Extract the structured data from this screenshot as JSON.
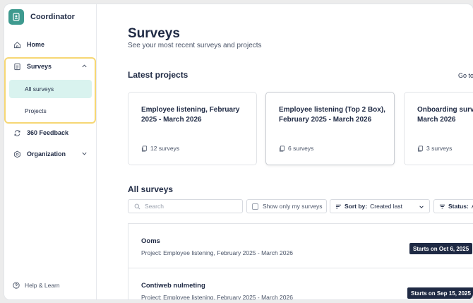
{
  "app": {
    "name": "Coordinator"
  },
  "sidebar": {
    "home": "Home",
    "surveys": "Surveys",
    "all_surveys": "All surveys",
    "projects": "Projects",
    "feedback": "360 Feedback",
    "organization": "Organization",
    "help": "Help & Learn"
  },
  "page": {
    "title": "Surveys",
    "subtitle": "See your most recent surveys and projects"
  },
  "latest_projects": {
    "title": "Latest projects",
    "goto": "Go to",
    "cards": [
      {
        "title_line1": "Employee listening, February",
        "title_line2": "2025 - March 2026",
        "count": "12 surveys"
      },
      {
        "title_line1": "Employee listening (Top 2 Box),",
        "title_line2": "February 2025 - March 2026",
        "count": "6 surveys"
      },
      {
        "title_line1": "Onboarding surv",
        "title_line2": "March 2026",
        "count": "3 surveys"
      }
    ]
  },
  "all_surveys": {
    "title": "All surveys",
    "search_placeholder": "Search",
    "only_mine": "Show only my surveys",
    "sort_label": "Sort by:",
    "sort_value": "Created last",
    "status_label": "Status:",
    "status_value": "Al",
    "rows": [
      {
        "name": "Ooms",
        "project": "Project: Employee listening, February 2025 - March 2026",
        "badge": "Starts on Oct 6, 2025"
      },
      {
        "name": "Contiweb nulmeting",
        "project": "Project: Employee listening, February 2025 - March 2026",
        "badge": "Starts on Sep 15, 2025"
      }
    ]
  },
  "colors": {
    "brand": "#3e9a8f",
    "active_bg": "#d9f3ef",
    "highlight": "#f6d774",
    "badge_bg": "#1f2a44"
  }
}
